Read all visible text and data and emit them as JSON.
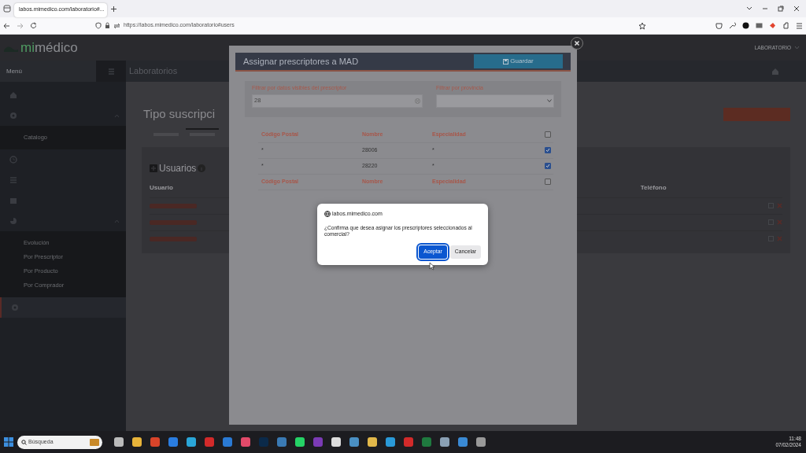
{
  "browser": {
    "tab_title": "labos.mimedico.com/laboratorio#...",
    "url": "https://labos.mimedico.com/laboratorio#users"
  },
  "app": {
    "logo_prefix": "mi",
    "logo_name": "médico",
    "user": "LABORATORIO",
    "menu_label": "Menú",
    "section": "Laboratorios"
  },
  "sidebar": [
    {
      "kind": "house",
      "selected": false
    },
    {
      "kind": "gear",
      "selected": false,
      "expanded": true,
      "children": [
        {
          "label": "Catalogo"
        }
      ]
    },
    {
      "kind": "clock",
      "selected": false
    },
    {
      "kind": "list",
      "selected": false
    },
    {
      "kind": "calendar",
      "selected": false
    },
    {
      "kind": "chart",
      "selected": false,
      "expanded": true,
      "children": [
        {
          "label": "Evolución"
        },
        {
          "label": "Por Prescriptor"
        },
        {
          "label": "Por Producto"
        },
        {
          "label": "Por Comprador"
        }
      ]
    },
    {
      "kind": "gear",
      "selected": true
    }
  ],
  "main": {
    "title": "Tipo suscripci",
    "tabs": [
      {
        "selected": false
      },
      {
        "selected": true
      }
    ],
    "panel_title": "Usuarios",
    "columns": [
      "Usuario",
      "Teléfono"
    ]
  },
  "modal": {
    "title": "Assignar prescriptores a MAD",
    "save_button": "Guardar",
    "filters": [
      {
        "kind": "text",
        "label": "Filtrar por datos visibles del prescriptor",
        "value": "28"
      },
      {
        "kind": "select",
        "label": "Filtrar por provincia"
      }
    ],
    "columns": [
      "Código Postal",
      "Nombre",
      "Especialidad"
    ],
    "header_checked": false,
    "rows": [
      {
        "cells": [
          "*",
          "28006",
          "*"
        ],
        "checked": true
      },
      {
        "cells": [
          "*",
          "28220",
          "*"
        ],
        "checked": true
      }
    ],
    "footer": {
      "cells": [
        "Código Postal",
        "Nombre",
        "Especialidad"
      ],
      "checked": false
    }
  },
  "dialog": {
    "origin": "labos.mimedico.com",
    "message": "¿Confirma que desea asignar los prescriptores seleccionados al comercial?",
    "buttons": [
      {
        "label": "Aceptar",
        "kind": "primary",
        "focused": true
      },
      {
        "label": "Cancelar",
        "kind": "secondary",
        "focused": false
      }
    ]
  },
  "taskbar": {
    "search_placeholder": "Búsqueda",
    "time": "11:48",
    "date": "07/02/2024"
  }
}
